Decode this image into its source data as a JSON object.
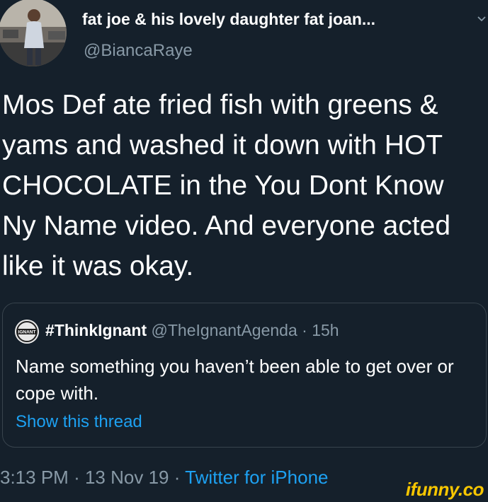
{
  "tweet": {
    "display_name": "fat joe & his lovely daughter fat joan...",
    "handle": "@BiancaRaye",
    "text": "Mos Def ate fried fish with greens & yams and washed it down with HOT CHOCOLATE in the You Dont Know Ny Name video. And everyone acted like it was okay.",
    "avatar_icon": "profile-photo-icon",
    "menu_icon": "chevron-down-icon"
  },
  "quoted": {
    "name": "#ThinkIgnant",
    "handle": "@TheIgnantAgenda",
    "separator": "·",
    "age": "15h",
    "text": "Name something you haven’t been able to get over or cope with.",
    "show_thread": "Show this thread",
    "avatar_icon": "ignant-logo-icon",
    "logo_text": "IGNANT"
  },
  "footer": {
    "time": "3:13 PM",
    "separator": "·",
    "date": "13 Nov 19",
    "source": "Twitter for iPhone"
  },
  "watermark": {
    "text": "ifunny.co",
    "color": "#f7c600"
  },
  "colors": {
    "background": "#15202b",
    "secondary_text": "#8899a6",
    "link": "#1da1f2",
    "border": "#38444d"
  }
}
